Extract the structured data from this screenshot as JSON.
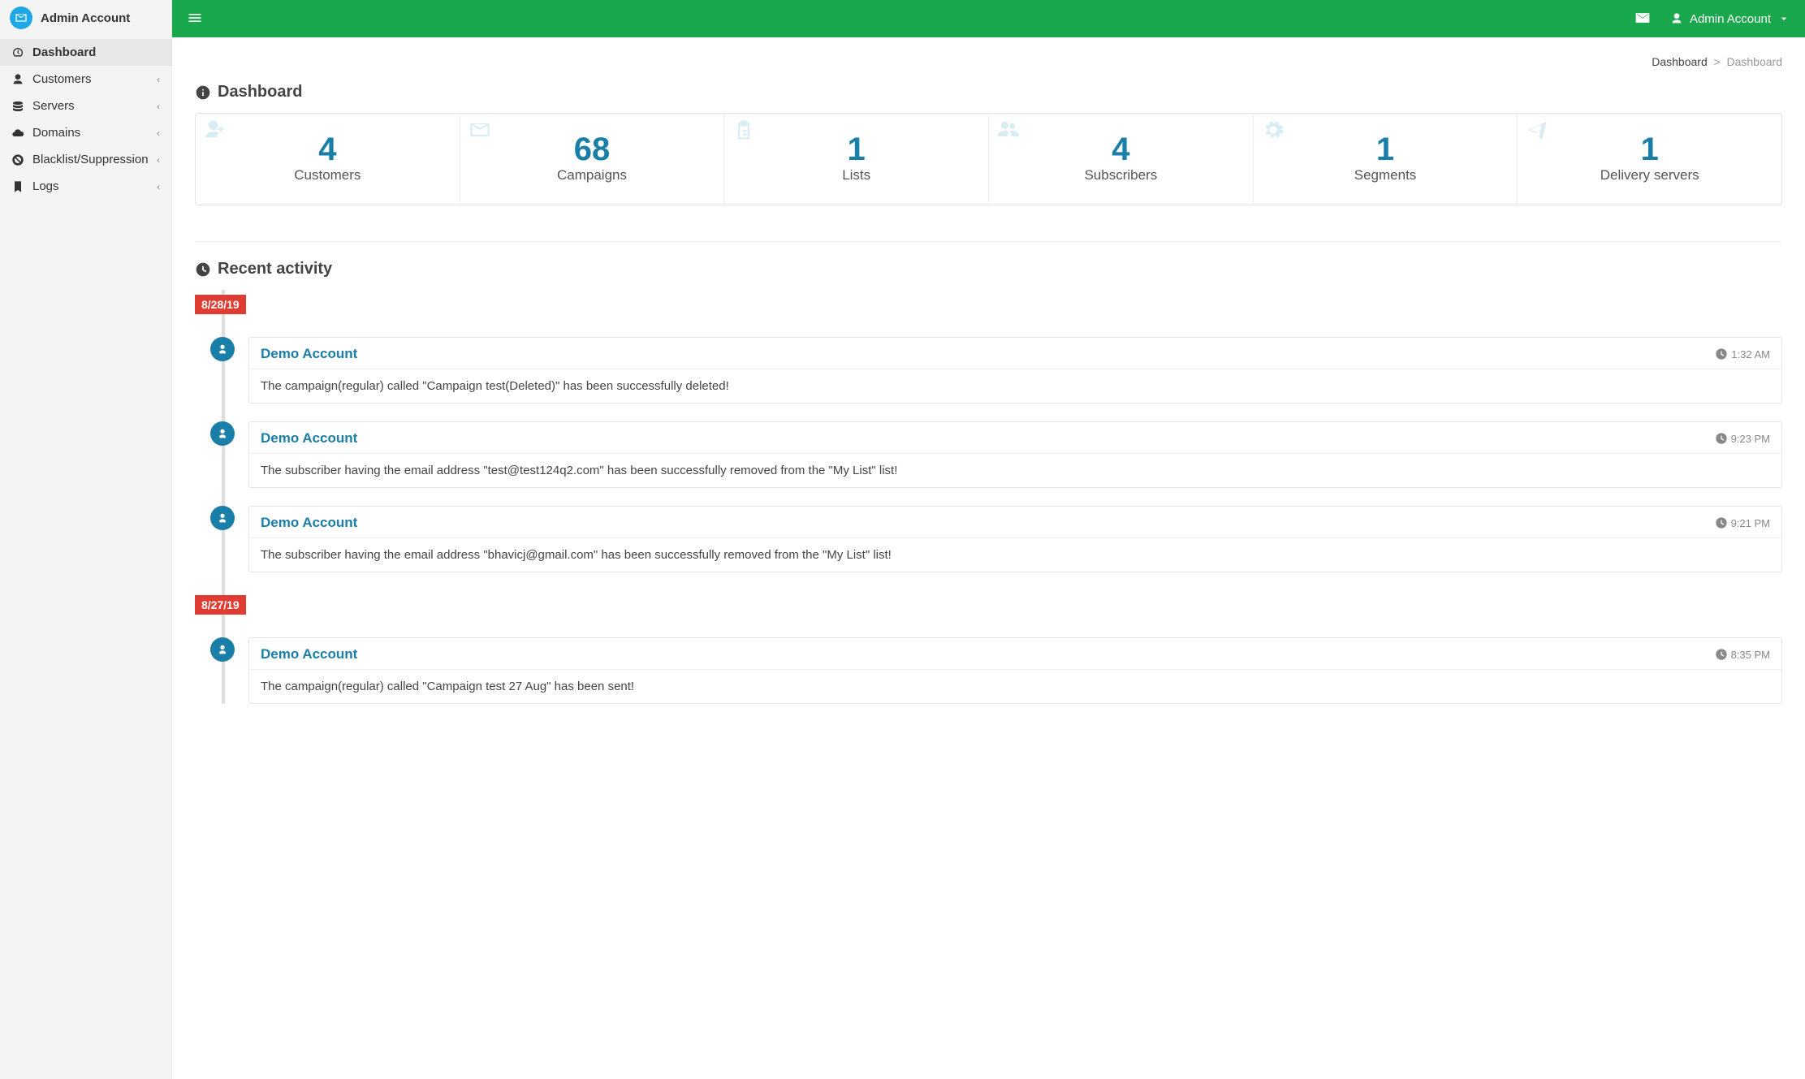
{
  "brand": {
    "title": "Admin Account"
  },
  "sidebar": {
    "items": [
      {
        "label": "Dashboard",
        "hasChildren": false,
        "active": true,
        "icon": "dashboard-icon"
      },
      {
        "label": "Customers",
        "hasChildren": true,
        "icon": "user-icon"
      },
      {
        "label": "Servers",
        "hasChildren": true,
        "icon": "server-icon"
      },
      {
        "label": "Domains",
        "hasChildren": true,
        "icon": "cloud-icon"
      },
      {
        "label": "Blacklist/Suppression",
        "hasChildren": true,
        "icon": "ban-icon"
      },
      {
        "label": "Logs",
        "hasChildren": true,
        "icon": "bookmark-icon"
      }
    ]
  },
  "topbar": {
    "user_label": "Admin Account"
  },
  "breadcrumb": {
    "root": "Dashboard",
    "current": "Dashboard"
  },
  "page": {
    "title": "Dashboard"
  },
  "stats": [
    {
      "value": "4",
      "label": "Customers",
      "icon": "user-plus-icon"
    },
    {
      "value": "68",
      "label": "Campaigns",
      "icon": "envelope-open-icon"
    },
    {
      "value": "1",
      "label": "Lists",
      "icon": "clipboard-icon"
    },
    {
      "value": "4",
      "label": "Subscribers",
      "icon": "users-icon"
    },
    {
      "value": "1",
      "label": "Segments",
      "icon": "gear-icon"
    },
    {
      "value": "1",
      "label": "Delivery servers",
      "icon": "paper-plane-icon"
    }
  ],
  "activity": {
    "title": "Recent activity",
    "groups": [
      {
        "date": "8/28/19",
        "items": [
          {
            "user": "Demo Account",
            "time": "1:32 AM",
            "text": "The campaign(regular) called \"Campaign test(Deleted)\" has been successfully deleted!"
          },
          {
            "user": "Demo Account",
            "time": "9:23 PM",
            "text": "The subscriber having the email address \"test@test124q2.com\" has been successfully removed from the \"My List\" list!"
          },
          {
            "user": "Demo Account",
            "time": "9:21 PM",
            "text": "The subscriber having the email address \"bhavicj@gmail.com\" has been successfully removed from the \"My List\" list!"
          }
        ]
      },
      {
        "date": "8/27/19",
        "items": [
          {
            "user": "Demo Account",
            "time": "8:35 PM",
            "text": "The campaign(regular) called \"Campaign test 27 Aug\" has been sent!"
          }
        ]
      }
    ]
  }
}
